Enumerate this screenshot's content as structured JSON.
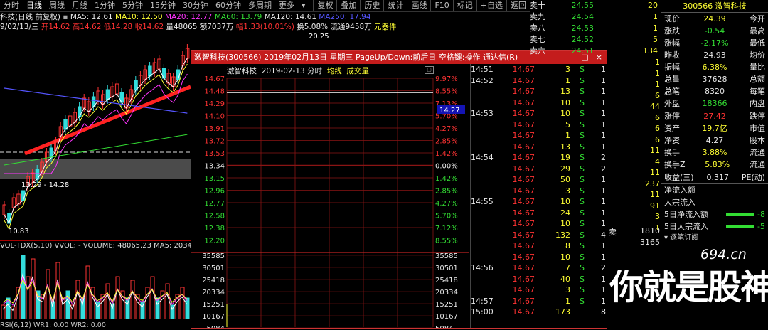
{
  "toolbar": {
    "left_items": [
      "分时",
      "日线",
      "周线",
      "月线",
      "1分钟",
      "5分钟",
      "15分钟",
      "30分钟",
      "60分钟",
      "多周期",
      "更多"
    ],
    "right_items": [
      "复权",
      "叠加",
      "历史",
      "统计",
      "画线",
      "F10",
      "标记",
      "+自选",
      "返回"
    ]
  },
  "infobar1": {
    "name": "科技(日线 前复权)",
    "ma5": "MA5: 12.61",
    "ma10": "MA10: 12.50",
    "ma20": "MA20: 12.77",
    "ma60": "MA60: 13.79",
    "ma120": "MA120: 14.61",
    "ma250": "MA250: 17.94"
  },
  "infobar2": {
    "date": "9/02/13/三",
    "open": "开14.62",
    "high": "高14.62",
    "low": "低14.28",
    "close": "收14.62",
    "vol": "量48065",
    "amount": "额7037万",
    "change": "幅1.33(10.01%)",
    "turnover": "换5.08%",
    "float": "流通9458万",
    "sector": "元器件"
  },
  "kchart": {
    "label_high": "20.25",
    "label_zone": "13.29 - 14.28",
    "label_low": "10.83",
    "colors": {
      "up": "#ff3333",
      "down": "#33dddd",
      "ma5": "#ffffff",
      "ma10": "#ffff33",
      "ma20": "#ff33ff",
      "ma60": "#33dd33",
      "ma120": "#5555ff"
    }
  },
  "volpanel": {
    "header": "VOL-TDX(5,10)  VVOL: -   VOLUME: 48065.23  MA5: 2034",
    "footer": "RSI(6,12)  WR1: 0.00   WR2: 0.00"
  },
  "popup": {
    "title": "激智科技(300566) 2019年02月13日 星期三 PageUp/Down:前后日 空格键:操作 通达信(R)",
    "controls": [
      "□",
      "×"
    ],
    "sub_name": "激智科技",
    "sub_date": "2019-02-13 分时",
    "sub_avg": "均线",
    "sub_vol": "成交量",
    "price_labels": [
      "14.67",
      "14.48",
      "14.29",
      "14.10",
      "13.91",
      "13.72",
      "13.53",
      "13.34",
      "13.15",
      "12.96",
      "12.77",
      "12.58",
      "12.38",
      "12.20"
    ],
    "pct_labels": [
      "9.97%",
      "8.55%",
      "7.13%",
      "5.70%",
      "4.27%",
      "2.85%",
      "1.42%",
      "0.00%",
      "1.42%",
      "2.85%",
      "4.27%",
      "5.70%",
      "7.12%",
      "8.55%"
    ],
    "current_price": "14.27",
    "vol_labels": [
      "35585",
      "30501",
      "25418",
      "20334",
      "15251",
      "10167",
      "5084"
    ],
    "trades": [
      {
        "time": "14:51",
        "price": "14.67",
        "vol": "3",
        "bs": "S",
        "n": "1"
      },
      {
        "time": "14:52",
        "price": "14.67",
        "vol": "1",
        "bs": "S",
        "n": "1"
      },
      {
        "time": "",
        "price": "14.67",
        "vol": "13",
        "bs": "S",
        "n": "1"
      },
      {
        "time": "",
        "price": "14.67",
        "vol": "10",
        "bs": "S",
        "n": "1"
      },
      {
        "time": "14:53",
        "price": "14.67",
        "vol": "10",
        "bs": "S",
        "n": "1"
      },
      {
        "time": "",
        "price": "14.67",
        "vol": "5",
        "bs": "S",
        "n": "1"
      },
      {
        "time": "",
        "price": "14.67",
        "vol": "1",
        "bs": "S",
        "n": "1"
      },
      {
        "time": "",
        "price": "14.67",
        "vol": "13",
        "bs": "S",
        "n": "1"
      },
      {
        "time": "14:54",
        "price": "14.67",
        "vol": "19",
        "bs": "S",
        "n": "2"
      },
      {
        "time": "",
        "price": "14.67",
        "vol": "29",
        "bs": "S",
        "n": "2"
      },
      {
        "time": "",
        "price": "14.67",
        "vol": "50",
        "bs": "S",
        "n": "1"
      },
      {
        "time": "",
        "price": "14.67",
        "vol": "3",
        "bs": "S",
        "n": "1"
      },
      {
        "time": "14:55",
        "price": "14.67",
        "vol": "10",
        "bs": "S",
        "n": "1"
      },
      {
        "time": "",
        "price": "14.67",
        "vol": "24",
        "bs": "S",
        "n": "1"
      },
      {
        "time": "",
        "price": "14.67",
        "vol": "10",
        "bs": "S",
        "n": "1"
      },
      {
        "time": "",
        "price": "14.67",
        "vol": "132",
        "bs": "S",
        "n": "4"
      },
      {
        "time": "",
        "price": "14.67",
        "vol": "8",
        "bs": "S",
        "n": "1"
      },
      {
        "time": "",
        "price": "14.67",
        "vol": "10",
        "bs": "S",
        "n": "1"
      },
      {
        "time": "14:56",
        "price": "14.67",
        "vol": "7",
        "bs": "S",
        "n": "2"
      },
      {
        "time": "",
        "price": "14.67",
        "vol": "40",
        "bs": "S",
        "n": "1"
      },
      {
        "time": "",
        "price": "14.67",
        "vol": "3",
        "bs": "S",
        "n": "1"
      },
      {
        "time": "14:57",
        "price": "14.67",
        "vol": "1",
        "bs": "S",
        "n": "1"
      },
      {
        "time": "15:00",
        "price": "14.67",
        "vol": "173",
        "bs": "",
        "n": "8"
      }
    ]
  },
  "orderbook": [
    {
      "label": "卖十",
      "price": "24.55",
      "vol": "20"
    },
    {
      "label": "卖九",
      "price": "24.54",
      "vol": "1"
    },
    {
      "label": "卖八",
      "price": "24.53",
      "vol": "1"
    },
    {
      "label": "卖七",
      "price": "24.52",
      "vol": "5"
    },
    {
      "label": "卖六",
      "price": "24.51",
      "vol": "134"
    }
  ],
  "side_vols": [
    "1",
    "1",
    "1",
    "6",
    "44",
    "6",
    "6",
    "6",
    "11",
    "4",
    "11",
    "237",
    "11",
    "91",
    "3",
    "1"
  ],
  "side_bottom": {
    "label": "卖",
    "vol": "1810",
    "vol2": "3165"
  },
  "quote": {
    "code_name": "300566 激智科技",
    "rows": [
      {
        "l": "现价",
        "v": "24.39",
        "r": "今开"
      },
      {
        "l": "涨跌",
        "v": "-0.54",
        "r": "最高"
      },
      {
        "l": "涨幅",
        "v": "-2.17%",
        "r": "最低"
      },
      {
        "l": "昨收",
        "v": "24.93",
        "r": "均价"
      },
      {
        "l": "振幅",
        "v": "6.38%",
        "r": "量比"
      },
      {
        "l": "总量",
        "v": "37628",
        "r": "总额"
      },
      {
        "l": "总笔",
        "v": "8320",
        "r": "每笔"
      },
      {
        "l": "外盘",
        "v": "18366",
        "r": "内盘"
      },
      {
        "l": "涨停",
        "v": "27.42",
        "r": "跌停"
      },
      {
        "l": "资产",
        "v": "19.7亿",
        "r": "市值"
      },
      {
        "l": "净资",
        "v": "4.27",
        "r": "股本"
      },
      {
        "l": "换手",
        "v": "3.88%",
        "r": "流通"
      },
      {
        "l": "换手Z",
        "v": "5.83%",
        "r": "流通"
      },
      {
        "l": "收益(三)",
        "v": "0.317",
        "r": "PE(动)"
      }
    ],
    "flow": [
      {
        "l": "净流入额",
        "v": ""
      },
      {
        "l": "大宗流入",
        "v": ""
      },
      {
        "l": "5日净流入额",
        "v": "-8"
      },
      {
        "l": "5日大宗流入",
        "v": "-5"
      }
    ],
    "footer_label": "逐笔订阅"
  },
  "watermark": {
    "small": "694.cn",
    "big": "你就是股神"
  }
}
